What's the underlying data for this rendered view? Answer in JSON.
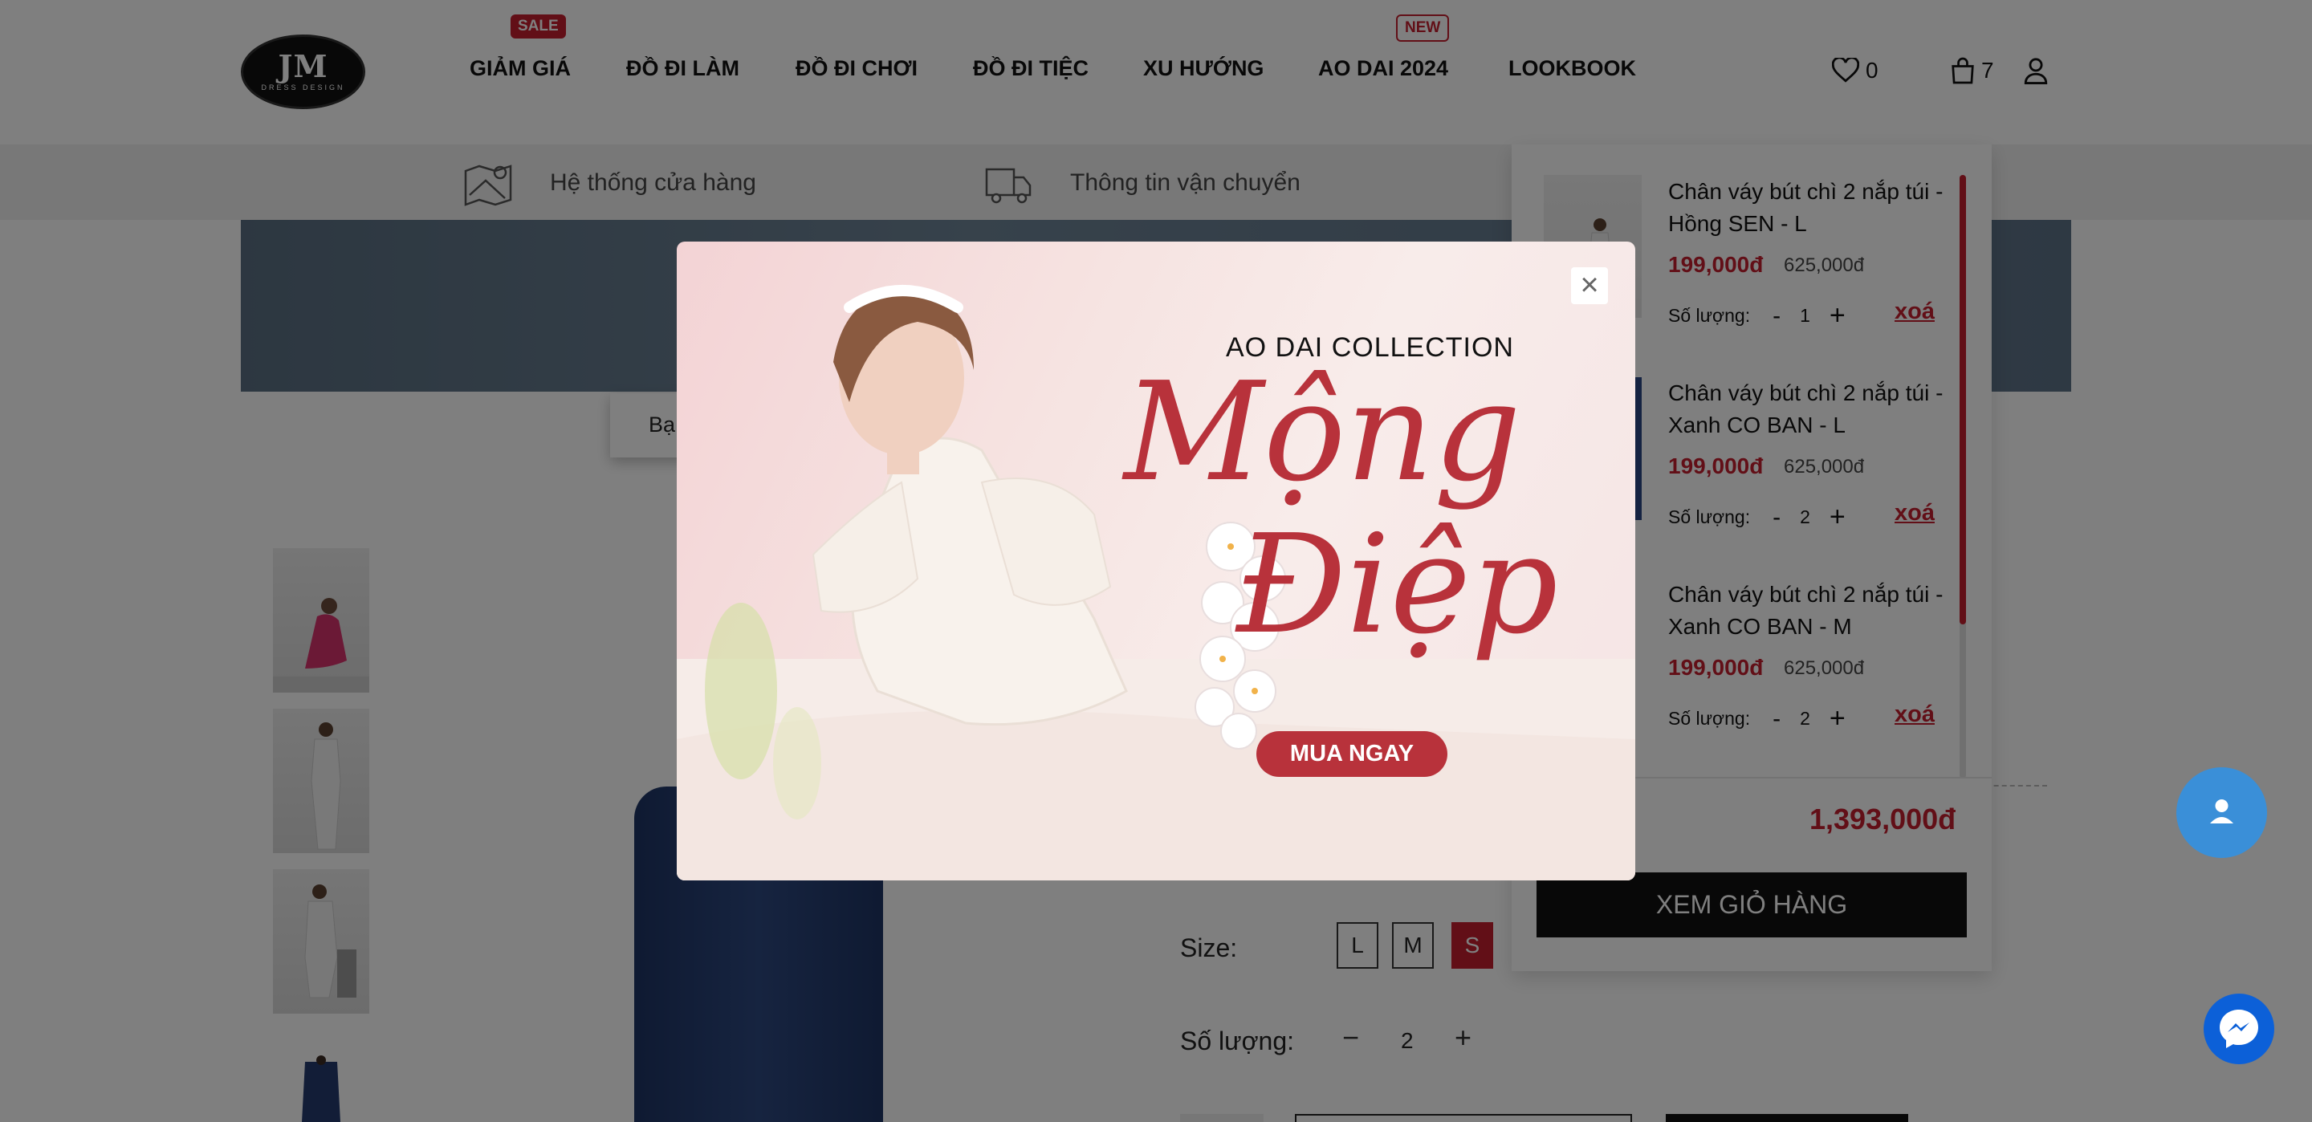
{
  "header": {
    "logo_text": "JM",
    "logo_sub": "DRESS DESIGN",
    "nav": [
      {
        "label": "GIẢM GIÁ",
        "badge": "SALE"
      },
      {
        "label": "ĐỒ ĐI LÀM"
      },
      {
        "label": "ĐỒ ĐI CHƠI"
      },
      {
        "label": "ĐỒ ĐI TIỆC"
      },
      {
        "label": "XU HƯỚNG"
      },
      {
        "label": "AO DAI 2024",
        "badge": "NEW"
      },
      {
        "label": "LOOKBOOK"
      }
    ],
    "wishlist_count": "0",
    "cart_count": "7"
  },
  "subbar": {
    "stores": "Hệ thống cửa hàng",
    "shipping": "Thông tin vận chuyển"
  },
  "breadcrumb": "Bạ",
  "product": {
    "size_label": "Size:",
    "sizes": [
      "L",
      "M",
      "S"
    ],
    "selected_size": "S",
    "qty_label": "Số lượng:",
    "qty": "2"
  },
  "cart": {
    "items": [
      {
        "name": "Chân váy bút chì 2 nắp túi - Hồng SEN - L",
        "price": "199,000đ",
        "old_price": "625,000đ",
        "qty_label": "Số lượng:",
        "qty": "1",
        "remove": "xoá"
      },
      {
        "name": "Chân váy bút chì 2 nắp túi - Xanh CO BAN - L",
        "price": "199,000đ",
        "old_price": "625,000đ",
        "qty_label": "Số lượng:",
        "qty": "2",
        "remove": "xoá"
      },
      {
        "name": "Chân váy bút chì 2 nắp túi - Xanh CO BAN - M",
        "price": "199,000đ",
        "old_price": "625,000đ",
        "qty_label": "Số lượng:",
        "qty": "2",
        "remove": "xoá"
      }
    ],
    "total": "1,393,000đ",
    "view_cart": "XEM GIỎ HÀNG"
  },
  "popup": {
    "collection": "AO DAI COLLECTION",
    "title_line1": "Mộng",
    "title_line2": "Điệp",
    "cta": "MUA NGAY",
    "close": "×"
  },
  "colors": {
    "brand_red": "#c41e2e",
    "popup_red": "#b8323b",
    "fab_blue": "#3a8fd8",
    "messenger_blue": "#0c60d8"
  }
}
